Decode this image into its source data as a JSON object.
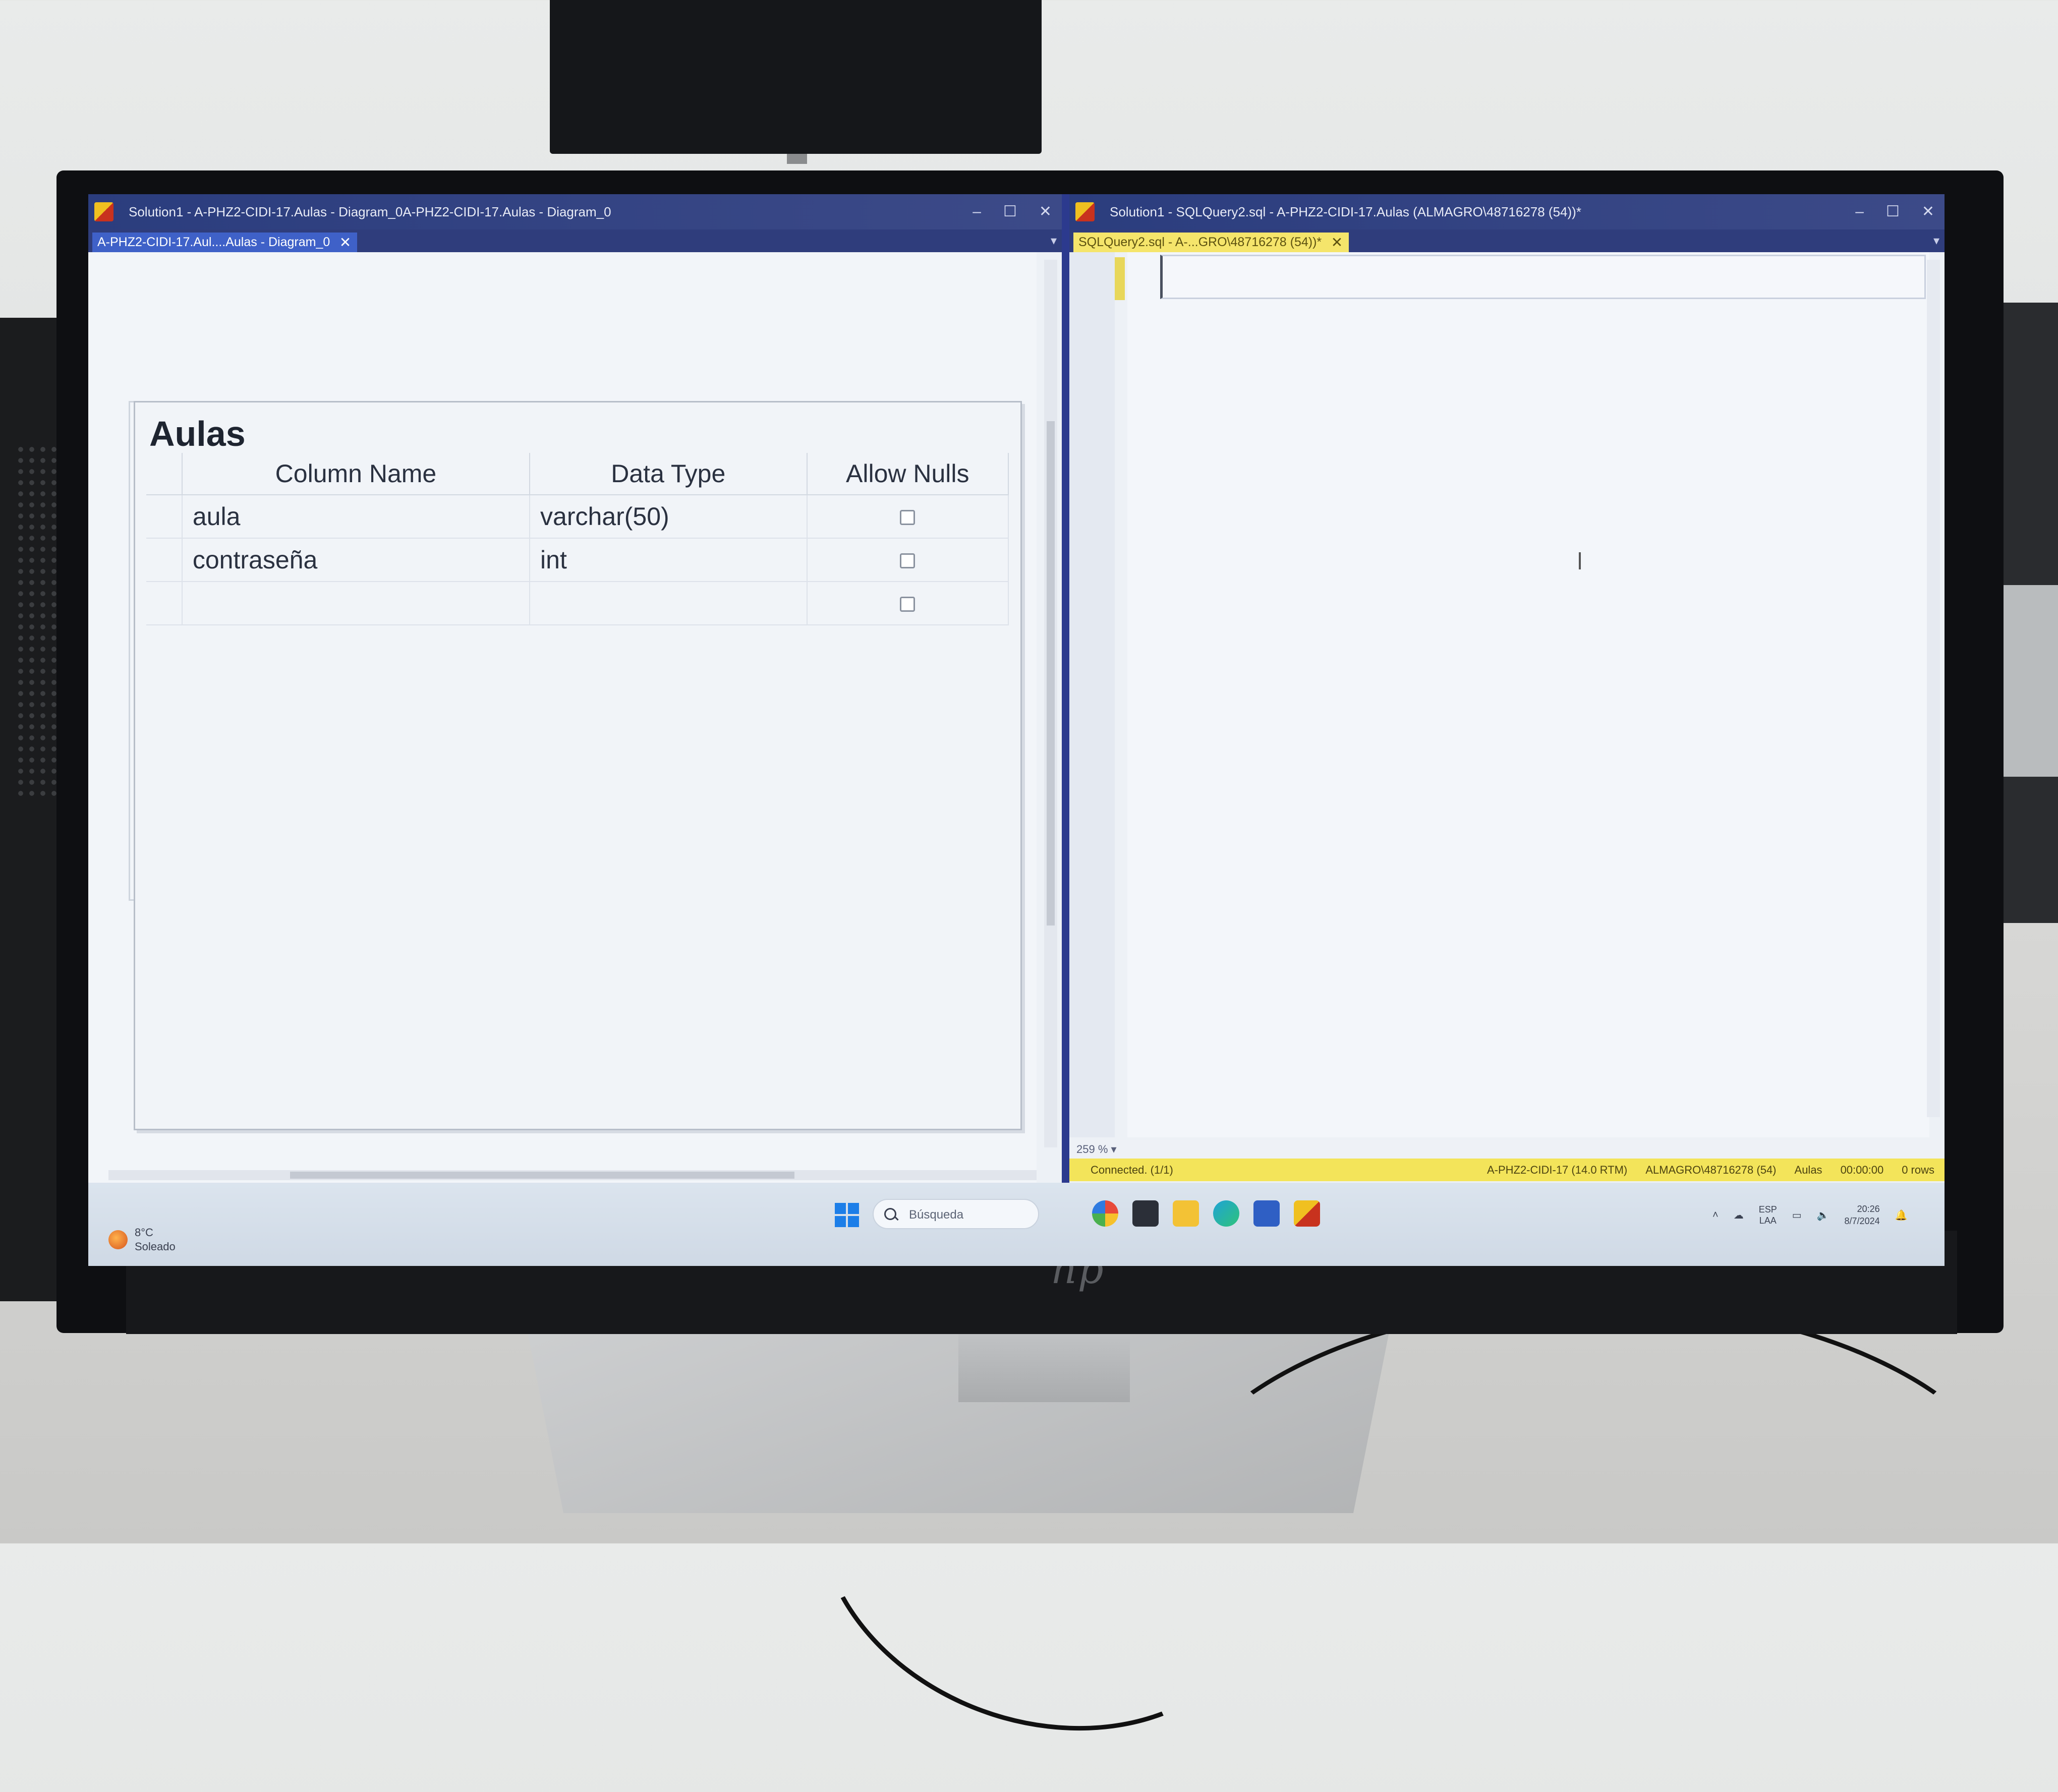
{
  "left_window": {
    "title": "Solution1 - A-PHZ2-CIDI-17.Aulas - Diagram_0A-PHZ2-CIDI-17.Aulas - Diagram_0",
    "tab_label": "A-PHZ2-CIDI-17.Aul....Aulas - Diagram_0",
    "tab_pin": "⊕",
    "tab_close": "✕"
  },
  "right_window": {
    "title": "Solution1 - SQLQuery2.sql - A-PHZ2-CIDI-17.Aulas (ALMAGRO\\48716278 (54))*",
    "tab_label": "SQLQuery2.sql - A-...GRO\\48716278 (54))*",
    "tab_pin": "⊕",
    "tab_close": "✕"
  },
  "window_controls": {
    "minimize": "–",
    "maximize": "☐",
    "close": "✕"
  },
  "diagram_table": {
    "name": "Aulas",
    "columns": [
      "Column Name",
      "Data Type",
      "Allow Nulls"
    ],
    "rows": [
      {
        "column_name": "aula",
        "data_type": "varchar(50)",
        "allow_nulls": false
      },
      {
        "column_name": "contraseña",
        "data_type": "int",
        "allow_nulls": false
      },
      {
        "column_name": "",
        "data_type": "",
        "allow_nulls": false
      }
    ]
  },
  "sql_editor": {
    "zoom": "259 %",
    "status": {
      "connection": "Connected. (1/1)",
      "server": "A-PHZ2-CIDI-17 (14.0 RTM)",
      "user": "ALMAGRO\\48716278 (54)",
      "database": "Aulas",
      "elapsed": "00:00:00",
      "rows": "0 rows"
    }
  },
  "taskbar": {
    "weather_temp": "8°C",
    "weather_desc": "Soleado",
    "search_placeholder": "Búsqueda",
    "language_line1": "ESP",
    "language_line2": "LAA",
    "time": "20:26",
    "date": "8/7/2024"
  },
  "monitor_brand": "hp"
}
